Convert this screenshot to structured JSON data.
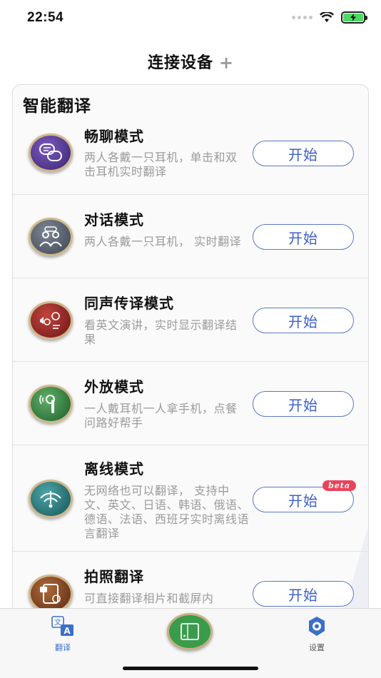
{
  "status_bar": {
    "time": "22:54"
  },
  "header": {
    "title": "连接设备",
    "plus": "+"
  },
  "section": {
    "title": "智能翻译"
  },
  "modes": [
    {
      "title": "畅聊模式",
      "desc": "两人各戴一只耳机，单击和双击耳机实时翻译",
      "button": "开始",
      "icon": "chat-bubbles-icon",
      "color": "#4b2e86"
    },
    {
      "title": "对话模式",
      "desc": "两人各戴一只耳机， 实时翻译",
      "button": "开始",
      "icon": "two-people-icon",
      "color": "#505a66"
    },
    {
      "title": "同声传译模式",
      "desc": "看英文演讲，实时显示翻译结果",
      "button": "开始",
      "icon": "interpretation-icon",
      "color": "#8e1f24"
    },
    {
      "title": "外放模式",
      "desc": "一人戴耳机一人拿手机，点餐问路好帮手",
      "button": "开始",
      "icon": "earbud-icon",
      "color": "#2f7a3f"
    },
    {
      "title": "离线模式",
      "desc": "无网络也可以翻译， 支持中文、英文、日语、韩语、俄语、德语、法语、西班牙实时离线语言翻译",
      "button": "开始",
      "badge": "beta",
      "icon": "offline-wifi-icon",
      "color": "#1f6b6a"
    },
    {
      "title": "拍照翻译",
      "desc": "可直接翻译相片和截屏内",
      "button": "开始",
      "icon": "photo-translate-icon",
      "color": "#7a3e1e"
    }
  ],
  "tab_bar": {
    "translate_label": "翻译",
    "settings_label": "设置"
  },
  "colors": {
    "accent": "#3d5fc7",
    "tab_active": "#3b6fc9",
    "beta": "#e8445c"
  }
}
